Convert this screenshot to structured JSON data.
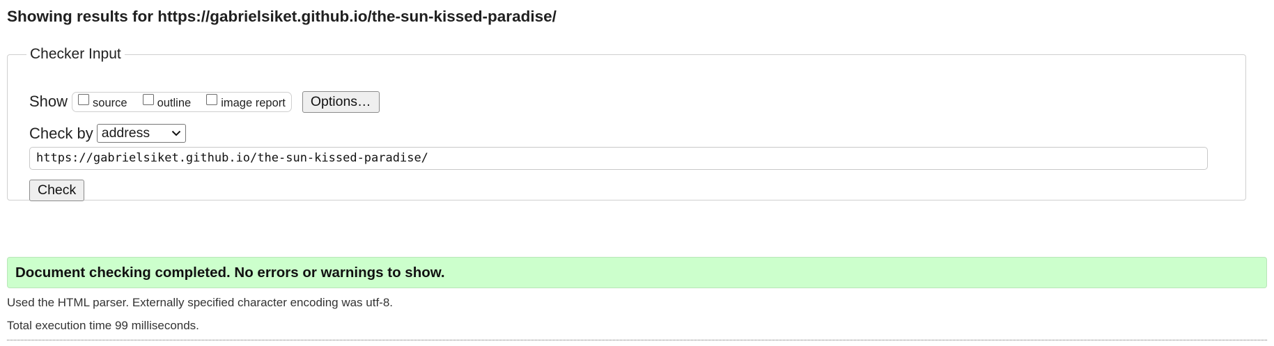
{
  "page": {
    "title": "Showing results for https://gabrielsiket.github.io/the-sun-kissed-paradise/"
  },
  "checker": {
    "legend": "Checker Input",
    "show_label": "Show",
    "options": [
      {
        "label": "source",
        "checked": false
      },
      {
        "label": "outline",
        "checked": false
      },
      {
        "label": "image report",
        "checked": false
      }
    ],
    "options_button": "Options…",
    "check_by_label": "Check by",
    "check_by_value": "address",
    "url_value": "https://gabrielsiket.github.io/the-sun-kissed-paradise/",
    "check_button": "Check"
  },
  "result": {
    "success_message": "Document checking completed. No errors or warnings to show.",
    "parser_info": "Used the HTML parser. Externally specified character encoding was utf-8.",
    "execution_time": "Total execution time 99 milliseconds."
  },
  "colors": {
    "success_bg": "#ccffcc",
    "button_bg": "#efefef"
  },
  "icons": {
    "select_arrow": "chevron-down-icon"
  }
}
